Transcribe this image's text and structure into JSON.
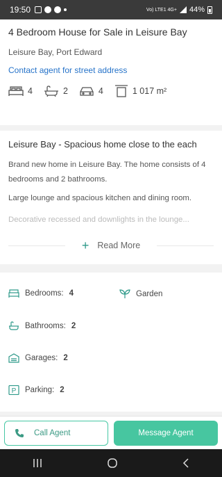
{
  "status_bar": {
    "time": "19:50",
    "network": "Vo) LTE1 4G+",
    "battery": "44%"
  },
  "listing": {
    "title": "4 Bedroom House for Sale in Leisure Bay",
    "location": "Leisure Bay, Port Edward",
    "contact_link": "Contact agent for street address",
    "features": {
      "bedrooms": "4",
      "bathrooms": "2",
      "garages": "4",
      "size": "1 017 m²"
    }
  },
  "description": {
    "title": "Leisure Bay - Spacious home close to the each",
    "paragraphs": [
      "Brand new home in Leisure Bay. The home consists of 4 bedrooms and 2 bathrooms.",
      "Large lounge and spacious kitchen and dining room.",
      "Decorative recessed and downlights in the lounge..."
    ],
    "read_more": "Read More"
  },
  "amenities": {
    "bedrooms_label": "Bedrooms:",
    "bedrooms_value": "4",
    "garden_label": "Garden",
    "bathrooms_label": "Bathrooms:",
    "bathrooms_value": "2",
    "garages_label": "Garages:",
    "garages_value": "2",
    "parking_label": "Parking:",
    "parking_value": "2"
  },
  "actions": {
    "call": "Call Agent",
    "message": "Message Agent"
  },
  "colors": {
    "accent": "#47c6a0",
    "link": "#2673c9",
    "icon": "#2f9a8a"
  }
}
